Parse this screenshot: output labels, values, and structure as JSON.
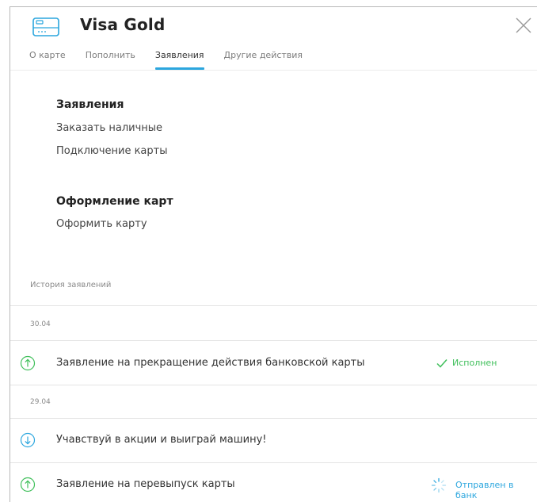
{
  "header": {
    "card_title": "Visa Gold"
  },
  "tabs": [
    {
      "label": "О карте",
      "active": false
    },
    {
      "label": "Пополнить",
      "active": false
    },
    {
      "label": "Заявления",
      "active": true
    },
    {
      "label": "Другие действия",
      "active": false
    }
  ],
  "applications": {
    "title": "Заявления",
    "items": [
      {
        "label": "Заказать наличные"
      },
      {
        "label": "Подключение карты"
      }
    ]
  },
  "card_issue": {
    "title": "Оформление карт",
    "items": [
      {
        "label": "Оформить карту"
      }
    ]
  },
  "history": {
    "caption": "История заявлений",
    "groups": [
      {
        "date": "30.04",
        "rows": [
          {
            "text": "Заявление на прекращение действия банковской карты",
            "direction_icon": "arrow-up-circle-icon",
            "status": "Исполнен",
            "status_icon": "checkmark-icon"
          }
        ]
      },
      {
        "date": "29.04",
        "rows": [
          {
            "text": "Учавствуй в акции и выиграй машину!",
            "direction_icon": "arrow-down-circle-icon",
            "status": "",
            "status_icon": ""
          },
          {
            "text": "Заявление на перевыпуск карты",
            "direction_icon": "arrow-up-circle-icon",
            "status": "Отправлен в банк",
            "status_icon": "spinner-icon"
          }
        ]
      }
    ]
  },
  "colors": {
    "accent_blue": "#2ba6de",
    "success_green": "#3fbf5a",
    "text_dark": "#222222",
    "text_muted": "#8a8a8a"
  }
}
